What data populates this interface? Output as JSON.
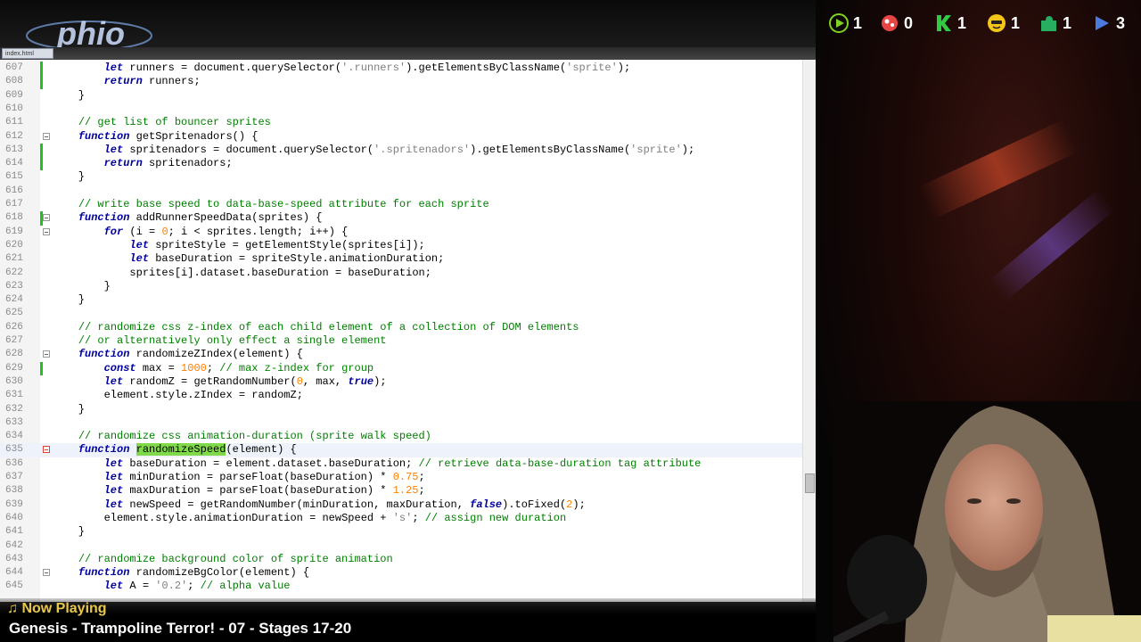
{
  "tab": {
    "label": "index.html"
  },
  "counters": [
    {
      "icon": "play-triangle-icon",
      "color": "#7ed321",
      "value": "1"
    },
    {
      "icon": "splat-icon",
      "color": "#e84545",
      "value": "0"
    },
    {
      "icon": "k-icon",
      "color": "#2ecc40",
      "value": "1"
    },
    {
      "icon": "emoji-icon",
      "color": "#f5c518",
      "value": "1"
    },
    {
      "icon": "puzzle-icon",
      "color": "#27ae60",
      "value": "1"
    },
    {
      "icon": "forward-icon",
      "color": "#4a7bdc",
      "value": "3"
    }
  ],
  "now_playing": {
    "label": "♫ Now Playing",
    "title": "Genesis - Trampoline Terror! - 07 - Stages 17-20"
  },
  "editor": {
    "lines": [
      {
        "n": "607",
        "code": "        let runners = document.querySelector('.runners').getElementsByClassName('sprite');"
      },
      {
        "n": "608",
        "code": "        return runners;"
      },
      {
        "n": "609",
        "code": "    }"
      },
      {
        "n": "610",
        "code": ""
      },
      {
        "n": "611",
        "code": "    // get list of bouncer sprites"
      },
      {
        "n": "612",
        "code": "    function getSpritenadors() {"
      },
      {
        "n": "613",
        "code": "        let spritenadors = document.querySelector('.spritenadors').getElementsByClassName('sprite');"
      },
      {
        "n": "614",
        "code": "        return spritenadors;"
      },
      {
        "n": "615",
        "code": "    }"
      },
      {
        "n": "616",
        "code": ""
      },
      {
        "n": "617",
        "code": "    // write base speed to data-base-speed attribute for each sprite"
      },
      {
        "n": "618",
        "code": "    function addRunnerSpeedData(sprites) {"
      },
      {
        "n": "619",
        "code": "        for (i = 0; i < sprites.length; i++) {"
      },
      {
        "n": "620",
        "code": "            let spriteStyle = getElementStyle(sprites[i]);"
      },
      {
        "n": "621",
        "code": "            let baseDuration = spriteStyle.animationDuration;"
      },
      {
        "n": "622",
        "code": "            sprites[i].dataset.baseDuration = baseDuration;"
      },
      {
        "n": "623",
        "code": "        }"
      },
      {
        "n": "624",
        "code": "    }"
      },
      {
        "n": "625",
        "code": ""
      },
      {
        "n": "626",
        "code": "    // randomize css z-index of each child element of a collection of DOM elements"
      },
      {
        "n": "627",
        "code": "    // or alternatively only effect a single element"
      },
      {
        "n": "628",
        "code": "    function randomizeZIndex(element) {"
      },
      {
        "n": "629",
        "code": "        const max = 1000; // max z-index for group"
      },
      {
        "n": "630",
        "code": "        let randomZ = getRandomNumber(0, max, true);"
      },
      {
        "n": "631",
        "code": "        element.style.zIndex = randomZ;"
      },
      {
        "n": "632",
        "code": "    }"
      },
      {
        "n": "633",
        "code": ""
      },
      {
        "n": "634",
        "code": "    // randomize css animation-duration (sprite walk speed)"
      },
      {
        "n": "635",
        "code": "    function randomizeSpeed(element) {"
      },
      {
        "n": "636",
        "code": "        let baseDuration = element.dataset.baseDuration; // retrieve data-base-duration tag attribute"
      },
      {
        "n": "637",
        "code": "        let minDuration = parseFloat(baseDuration) * 0.75;"
      },
      {
        "n": "638",
        "code": "        let maxDuration = parseFloat(baseDuration) * 1.25;"
      },
      {
        "n": "639",
        "code": "        let newSpeed = getRandomNumber(minDuration, maxDuration, false).toFixed(2);"
      },
      {
        "n": "640",
        "code": "        element.style.animationDuration = newSpeed + 's'; // assign new duration"
      },
      {
        "n": "641",
        "code": "    }"
      },
      {
        "n": "642",
        "code": ""
      },
      {
        "n": "643",
        "code": "    // randomize background color of sprite animation"
      },
      {
        "n": "644",
        "code": "    function randomizeBgColor(element) {"
      },
      {
        "n": "645",
        "code": "        let A = '0.2'; // alpha value"
      }
    ],
    "changed_lines": [
      "607",
      "608",
      "613",
      "614",
      "618",
      "629"
    ],
    "fold_markers": [
      "612",
      "618",
      "619",
      "628",
      "635",
      "644"
    ],
    "active_fold": "635",
    "current_line": "635",
    "highlight_word": "randomizeSpeed"
  }
}
